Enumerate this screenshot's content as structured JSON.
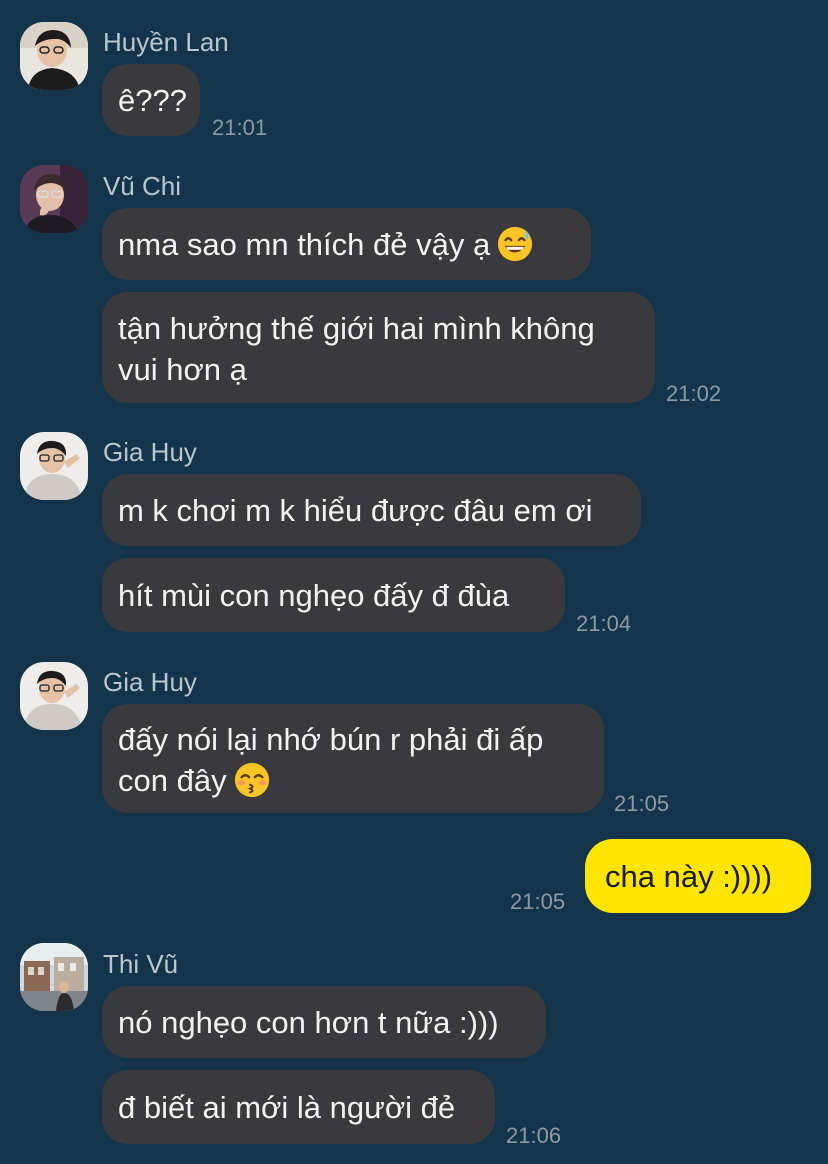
{
  "messages": {
    "g1": {
      "sender": "Huyền Lan",
      "bubble1": "ê???",
      "time": "21:01"
    },
    "g2": {
      "sender": "Vũ Chi",
      "bubble1": "nma sao mn thích đẻ vậy ạ",
      "bubble1_emoji": "grinning-sweat-emoji",
      "bubble2": "tận hưởng thế giới hai mình không\nvui hơn ạ",
      "time": "21:02"
    },
    "g3": {
      "sender": "Gia Huy",
      "bubble1": "m k chơi m k hiểu được đâu em ơi",
      "bubble2": "hít mùi con nghẹo đấy đ đùa",
      "time": "21:04"
    },
    "g4": {
      "sender": "Gia Huy",
      "bubble1": "đấy nói lại nhớ bún r phải đi ấp\ncon đây",
      "bubble1_emoji": "kissing-smiling-eyes-emoji",
      "time": "21:05"
    },
    "mine": {
      "bubble": "cha này :))))",
      "time": "21:05"
    },
    "g5": {
      "sender": "Thi Vũ",
      "bubble1": "nó nghẹo con hơn t nữa :)))",
      "bubble2": "đ biết ai mới là người đẻ",
      "time": "21:06"
    }
  },
  "colors": {
    "background": "#13344a",
    "incoming_bubble": "#3a3a3c",
    "outgoing_bubble": "#fee500",
    "sender_name": "#b9c6d0",
    "timestamp": "#8c9aa6"
  }
}
